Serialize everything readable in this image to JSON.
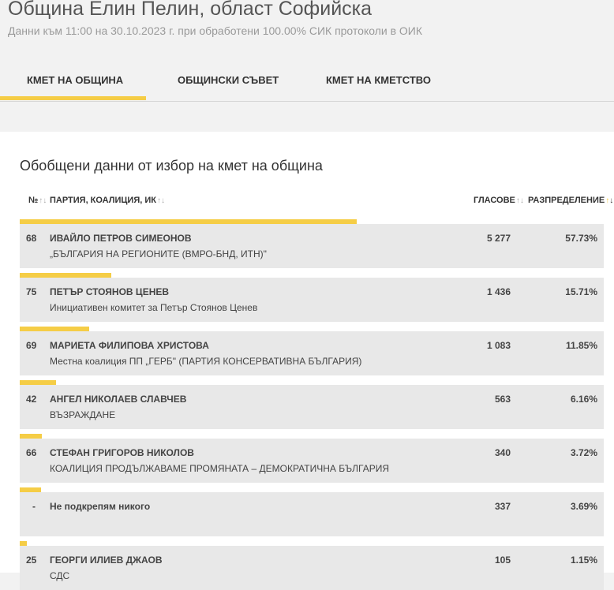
{
  "header": {
    "title": "Община Елин Пелин, област Софийска",
    "subtitle": "Данни към 11:00 на 30.10.2023 г. при обработени 100.00% СИК протоколи в ОИК"
  },
  "tabs": [
    {
      "label": "КМЕТ НА ОБЩИНА",
      "active": true
    },
    {
      "label": "ОБЩИНСКИ СЪВЕТ",
      "active": false
    },
    {
      "label": "КМЕТ НА КМЕТСТВО",
      "active": false
    }
  ],
  "colors": {
    "accent": "#f5cd46",
    "row_bg": "#e8e8e8"
  },
  "section": {
    "title": "Обобщени данни от избор на кмет на община"
  },
  "table": {
    "headers": {
      "num": "№",
      "party": "ПАРТИЯ, КОАЛИЦИЯ, ИК",
      "votes": "ГЛАСОВЕ",
      "share": "РАЗПРЕДЕЛЕНИЕ"
    },
    "sort_icon": "↑↓",
    "rows": [
      {
        "num": "68",
        "name": "ИВАЙЛО ПЕТРОВ СИМЕОНОВ",
        "party": "„БЪЛГАРИЯ НА РЕГИОНИТЕ (ВМРО-БНД, ИТН)\"",
        "votes": "5 277",
        "pct": "57.73%",
        "share": 57.73
      },
      {
        "num": "75",
        "name": "ПЕТЪР СТОЯНОВ ЦЕНЕВ",
        "party": "Инициативен комитет за Петър Стоянов Ценев",
        "votes": "1 436",
        "pct": "15.71%",
        "share": 15.71
      },
      {
        "num": "69",
        "name": "МАРИЕТА ФИЛИПОВА ХРИСТОВА",
        "party": "Местна коалиция ПП „ГЕРБ\" (ПАРТИЯ КОНСЕРВАТИВНА БЪЛГАРИЯ)",
        "votes": "1 083",
        "pct": "11.85%",
        "share": 11.85
      },
      {
        "num": "42",
        "name": "АНГЕЛ НИКОЛАЕВ СЛАВЧЕВ",
        "party": "ВЪЗРАЖДАНЕ",
        "votes": "563",
        "pct": "6.16%",
        "share": 6.16
      },
      {
        "num": "66",
        "name": "СТЕФАН ГРИГОРОВ НИКОЛОВ",
        "party": "КОАЛИЦИЯ ПРОДЪЛЖАВАМЕ ПРОМЯНАТА – ДЕМОКРАТИЧНА БЪЛГАРИЯ",
        "votes": "340",
        "pct": "3.72%",
        "share": 3.72
      },
      {
        "num": "-",
        "name": "Не подкрепям никого",
        "party": "",
        "votes": "337",
        "pct": "3.69%",
        "share": 3.69
      },
      {
        "num": "25",
        "name": "ГЕОРГИ ИЛИЕВ ДЖАОВ",
        "party": "СДС",
        "votes": "105",
        "pct": "1.15%",
        "share": 1.15
      }
    ]
  }
}
